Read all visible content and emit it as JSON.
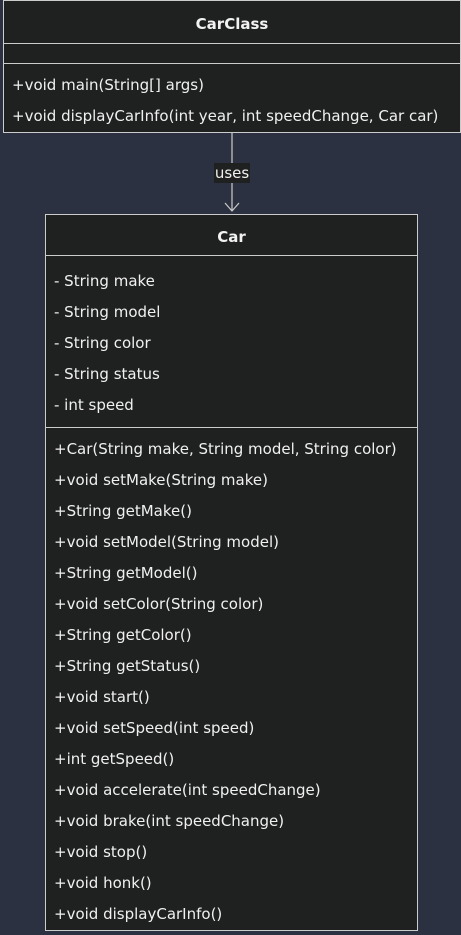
{
  "classes": {
    "carclass": {
      "name": "CarClass",
      "attributes": [],
      "methods": [
        "+void main(String[] args)",
        "+void displayCarInfo(int year, int speedChange, Car car)"
      ]
    },
    "car": {
      "name": "Car",
      "attributes": [
        "- String make",
        "- String model",
        "- String color",
        "- String status",
        "- int speed"
      ],
      "methods": [
        "+Car(String make, String model, String color)",
        "+void setMake(String make)",
        "+String getMake()",
        "+void setModel(String model)",
        "+String getModel()",
        "+void setColor(String color)",
        "+String getColor()",
        "+String getStatus()",
        "+void start()",
        "+void setSpeed(int speed)",
        "+int getSpeed()",
        "+void accelerate(int speedChange)",
        "+void brake(int speedChange)",
        "+void stop()",
        "+void honk()",
        "+void displayCarInfo()"
      ]
    }
  },
  "relations": [
    {
      "from": "CarClass",
      "to": "Car",
      "label": "uses"
    }
  ]
}
